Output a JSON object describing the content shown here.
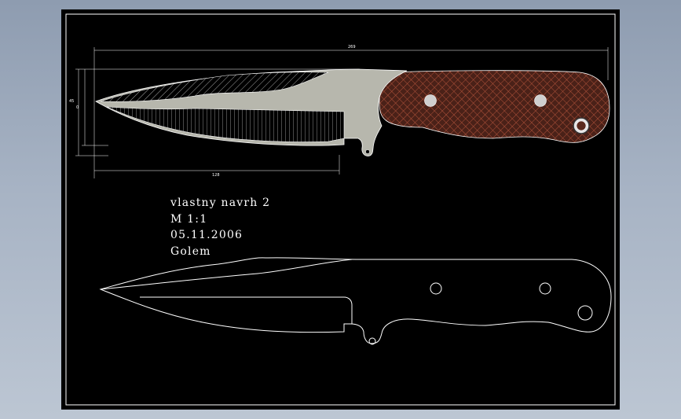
{
  "drawing": {
    "title_lines": [
      "vlastny navrh 2",
      "M 1:1",
      "05.11.2006",
      "Golem"
    ],
    "dimensions": {
      "overall_length": "269",
      "blade_length": "128",
      "height_left": "45",
      "height_inner": "0"
    }
  },
  "colors": {
    "screen_background": "#a7b3c4",
    "sheet_background": "#000000",
    "outline": "#ffffff",
    "blade_fill": "#b7b7ad",
    "handle_fill": "#5a2a1e",
    "handle_pattern": "#b0523a"
  }
}
